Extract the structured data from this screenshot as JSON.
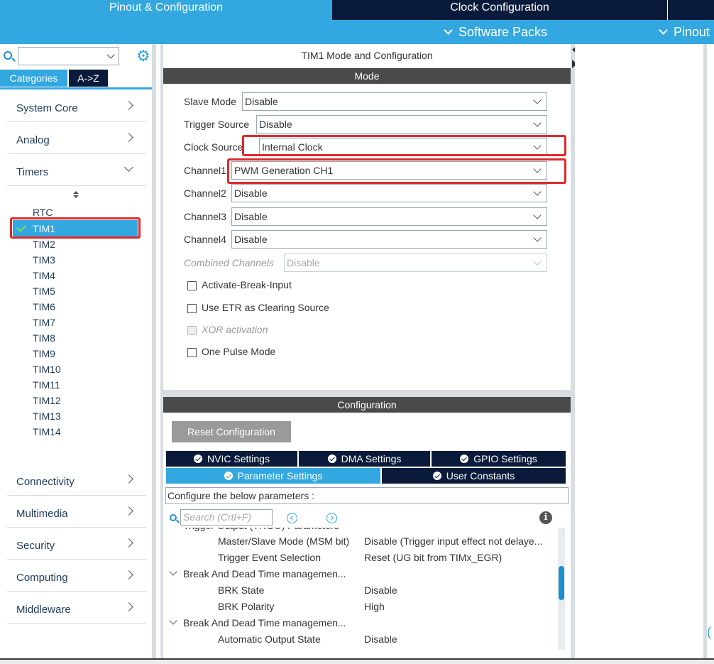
{
  "top_tabs": {
    "pinout": "Pinout & Configuration",
    "clock": "Clock Configuration"
  },
  "subbar": {
    "software_packs": "Software Packs",
    "pinout": "Pinout"
  },
  "sidebar": {
    "search_placeholder": "",
    "tabs": {
      "categories": "Categories",
      "az": "A->Z"
    },
    "categories": [
      "System Core",
      "Analog",
      "Timers",
      "Connectivity",
      "Multimedia",
      "Security",
      "Computing",
      "Middleware"
    ],
    "timers": [
      "RTC",
      "TIM1",
      "TIM2",
      "TIM3",
      "TIM4",
      "TIM5",
      "TIM6",
      "TIM7",
      "TIM8",
      "TIM9",
      "TIM10",
      "TIM11",
      "TIM12",
      "TIM13",
      "TIM14"
    ],
    "selected_timer": "TIM1"
  },
  "mode_panel": {
    "title": "TIM1 Mode and Configuration",
    "mode_header": "Mode",
    "fields": [
      {
        "label": "Slave Mode",
        "value": "Disable"
      },
      {
        "label": "Trigger Source",
        "value": "Disable"
      },
      {
        "label": "Clock Source",
        "value": "Internal Clock"
      },
      {
        "label": "Channel1",
        "value": "PWM Generation CH1"
      },
      {
        "label": "Channel2",
        "value": "Disable"
      },
      {
        "label": "Channel3",
        "value": "Disable"
      },
      {
        "label": "Channel4",
        "value": "Disable"
      },
      {
        "label": "Combined Channels",
        "value": "Disable"
      }
    ],
    "checkboxes": [
      {
        "label": "Activate-Break-Input",
        "checked": false,
        "enabled": true
      },
      {
        "label": "Use ETR as Clearing Source",
        "checked": false,
        "enabled": true
      },
      {
        "label": "XOR activation",
        "checked": false,
        "enabled": false
      },
      {
        "label": "One Pulse Mode",
        "checked": false,
        "enabled": true
      }
    ]
  },
  "config_panel": {
    "header": "Configuration",
    "reset_button": "Reset Configuration",
    "tabs_row1": [
      "NVIC Settings",
      "DMA Settings",
      "GPIO Settings"
    ],
    "tabs_row2": [
      "Parameter Settings",
      "User Constants"
    ],
    "hint": "Configure the below parameters :",
    "search_placeholder": "Search (Crtl+F)",
    "params": {
      "partial_group": "Trigger Output (TRGO) Parameters",
      "msm_label": "Master/Slave Mode (MSM bit)",
      "msm_value": "Disable (Trigger input effect not delaye...",
      "tes_label": "Trigger Event Selection",
      "tes_value": "Reset (UG bit from TIMx_EGR)",
      "group1": "Break And Dead Time managemen...",
      "brk_state_label": "BRK State",
      "brk_state_value": "Disable",
      "brk_pol_label": "BRK Polarity",
      "brk_pol_value": "High",
      "group2": "Break And Dead Time managemen...",
      "aos_label": "Automatic Output State",
      "aos_value": "Disable"
    }
  },
  "colors": {
    "accent": "#33a7e0",
    "dark_navy": "#0a1a3a",
    "highlight_red": "#e02a2a",
    "check_green": "#7cdc4a"
  }
}
